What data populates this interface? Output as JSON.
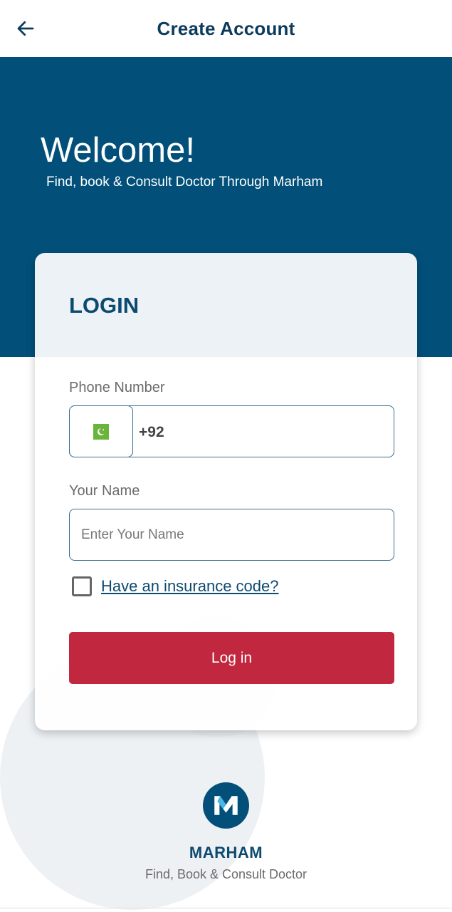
{
  "header": {
    "title": "Create Account",
    "back_icon": "arrow-left-icon"
  },
  "hero": {
    "title": "Welcome!",
    "subtitle": "Find, book & Consult Doctor Through Marham"
  },
  "login_card": {
    "title": "LOGIN",
    "phone": {
      "label": "Phone Number",
      "country_flag": "pakistan-flag-icon",
      "country_code": "+92"
    },
    "name": {
      "label": "Your Name",
      "placeholder": "Enter Your Name",
      "value": ""
    },
    "insurance": {
      "checked": false,
      "link_text": "Have an insurance code?"
    },
    "login_button": "Log in"
  },
  "brand": {
    "logo_icon": "marham-logo-icon",
    "name": "MARHAM",
    "tagline": "Find, Book & Consult Doctor"
  },
  "colors": {
    "primary": "#02507a",
    "accent": "#c1273f",
    "heading": "#0d4a70"
  }
}
